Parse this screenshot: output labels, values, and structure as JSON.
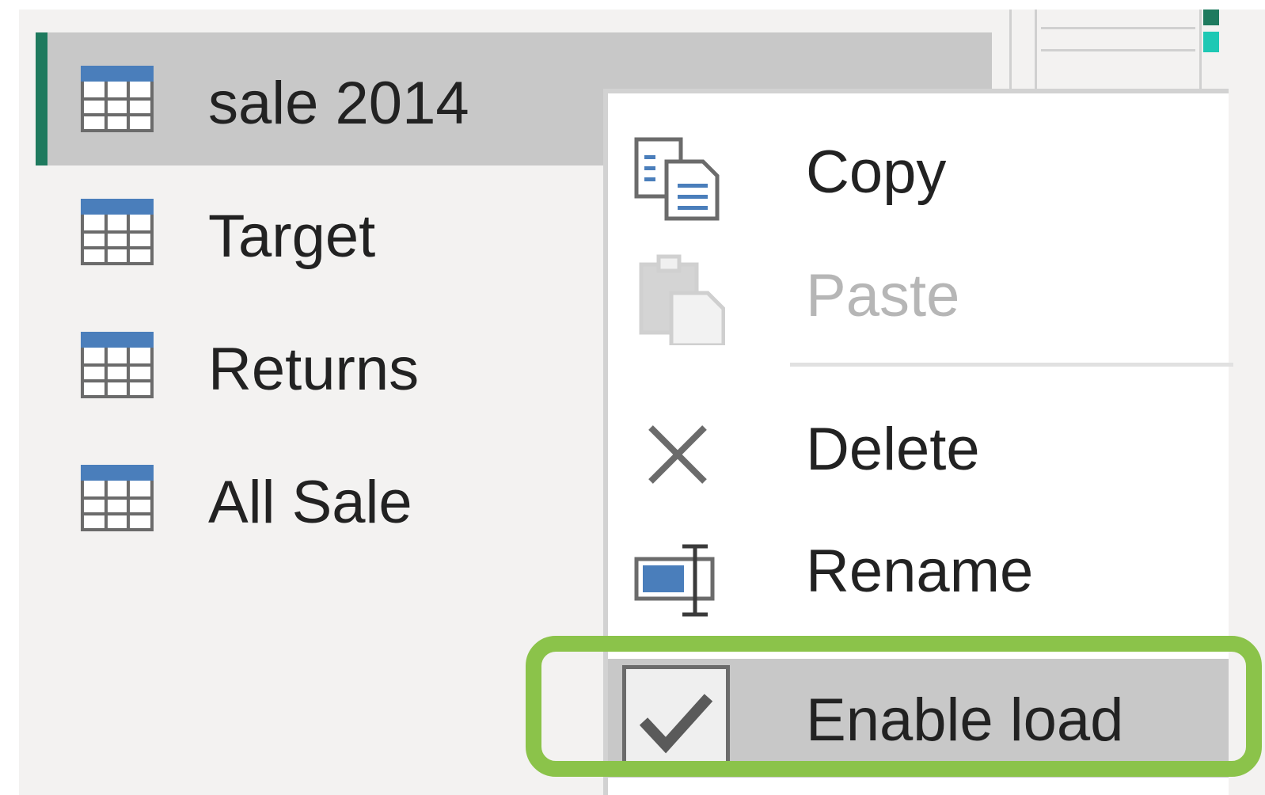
{
  "queries": [
    {
      "name": "sale 2014",
      "icon": "table-icon",
      "selected": true
    },
    {
      "name": "Target",
      "icon": "table-icon",
      "selected": false
    },
    {
      "name": "Returns",
      "icon": "table-icon",
      "selected": false
    },
    {
      "name": "All Sale",
      "icon": "table-icon",
      "selected": false
    }
  ],
  "context_menu": {
    "copy": {
      "label": "Copy",
      "icon": "copy-icon",
      "enabled": true
    },
    "paste": {
      "label": "Paste",
      "icon": "paste-icon",
      "enabled": false
    },
    "delete": {
      "label": "Delete",
      "icon": "delete-icon",
      "enabled": true
    },
    "rename": {
      "label": "Rename",
      "icon": "rename-icon",
      "enabled": true
    },
    "enable_load": {
      "label": "Enable load",
      "icon": "check-icon",
      "checked": true
    }
  },
  "colors": {
    "accent": "#1e7a5e",
    "selection": "#c8c8c8",
    "highlight": "#8bc34a",
    "icon_blue": "#4a7ebb"
  }
}
